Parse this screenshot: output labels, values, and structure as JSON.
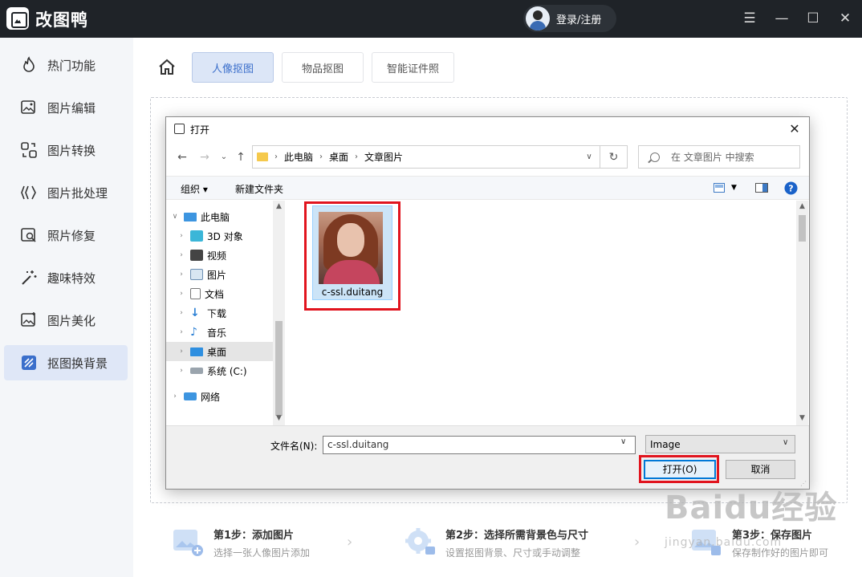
{
  "app": {
    "title": "改图鸭",
    "login_label": "登录/注册",
    "window_controls": [
      "menu-icon",
      "minimize-icon",
      "maximize-icon",
      "close-icon"
    ]
  },
  "sidebar": {
    "items": [
      {
        "label": "热门功能",
        "icon": "flame-icon",
        "active": false
      },
      {
        "label": "图片编辑",
        "icon": "image-edit-icon",
        "active": false
      },
      {
        "label": "图片转换",
        "icon": "convert-icon",
        "active": false
      },
      {
        "label": "图片批处理",
        "icon": "batch-icon",
        "active": false
      },
      {
        "label": "照片修复",
        "icon": "photo-repair-icon",
        "active": false
      },
      {
        "label": "趣味特效",
        "icon": "magic-wand-icon",
        "active": false
      },
      {
        "label": "图片美化",
        "icon": "beautify-icon",
        "active": false
      },
      {
        "label": "抠图换背景",
        "icon": "cutout-icon",
        "active": true
      }
    ]
  },
  "main": {
    "tabs": [
      {
        "label": "人像抠图",
        "active": true
      },
      {
        "label": "物品抠图",
        "active": false
      },
      {
        "label": "智能证件照",
        "active": false
      }
    ],
    "steps": [
      {
        "title": "第1步：添加图片",
        "desc": "选择一张人像图片添加"
      },
      {
        "title": "第2步：选择所需背景色与尺寸",
        "desc": "设置抠图背景、尺寸或手动调整"
      },
      {
        "title": "第3步：保存图片",
        "desc": "保存制作好的图片即可"
      }
    ]
  },
  "dialog": {
    "title": "打开",
    "breadcrumb": [
      "此电脑",
      "桌面",
      "文章图片"
    ],
    "search_placeholder": "在 文章图片 中搜索",
    "toolbar": {
      "organize": "组织",
      "new_folder": "新建文件夹"
    },
    "tree": [
      {
        "label": "此电脑",
        "icon": "computer-icon",
        "level": 0,
        "expanded": true,
        "selected": false
      },
      {
        "label": "3D 对象",
        "icon": "cube-icon",
        "level": 1,
        "expanded": false,
        "selected": false
      },
      {
        "label": "视频",
        "icon": "video-icon",
        "level": 1,
        "expanded": false,
        "selected": false
      },
      {
        "label": "图片",
        "icon": "picture-icon",
        "level": 1,
        "expanded": false,
        "selected": false
      },
      {
        "label": "文档",
        "icon": "document-icon",
        "level": 1,
        "expanded": false,
        "selected": false
      },
      {
        "label": "下载",
        "icon": "download-icon",
        "level": 1,
        "expanded": false,
        "selected": false
      },
      {
        "label": "音乐",
        "icon": "music-icon",
        "level": 1,
        "expanded": false,
        "selected": false
      },
      {
        "label": "桌面",
        "icon": "desktop-icon",
        "level": 1,
        "expanded": false,
        "selected": true
      },
      {
        "label": "系统 (C:)",
        "icon": "drive-icon",
        "level": 1,
        "expanded": false,
        "selected": false
      },
      {
        "label": "网络",
        "icon": "network-icon",
        "level": 0,
        "expanded": false,
        "selected": false
      }
    ],
    "files": [
      {
        "name": "c-ssl.duitang",
        "selected": true
      }
    ],
    "filename_label": "文件名(N):",
    "filename_value": "c-ssl.duitang",
    "filetype_value": "Image",
    "open_label": "打开(O)",
    "cancel_label": "取消"
  },
  "watermark": {
    "main": "Baidu经验",
    "sub": "jingyan.baidu.com"
  },
  "colors": {
    "titlebar": "#1f2328",
    "accent": "#3b6fcb",
    "highlight_red": "#e1141e",
    "selection": "#cce4f7"
  }
}
